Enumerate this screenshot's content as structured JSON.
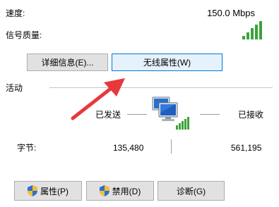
{
  "details": {
    "speed_label": "速度:",
    "speed_value": "150.0 Mbps",
    "signal_label": "信号质量:",
    "signal_level": 5,
    "signal_max": 5
  },
  "top_buttons": {
    "details": "详细信息(E)...",
    "wireless_properties": "无线属性(W)"
  },
  "activity": {
    "section_label": "活动",
    "sent_label": "已发送",
    "received_label": "已接收",
    "bytes_label": "字节:",
    "sent_value": "135,480",
    "received_value": "561,195"
  },
  "bottom_buttons": {
    "properties": "属性(P)",
    "disable": "禁用(D)",
    "diagnose": "诊断(G)"
  },
  "colors": {
    "signal_green": "#3aa33a",
    "arrow_red": "#e8383d",
    "focus_border": "#0078d7"
  }
}
